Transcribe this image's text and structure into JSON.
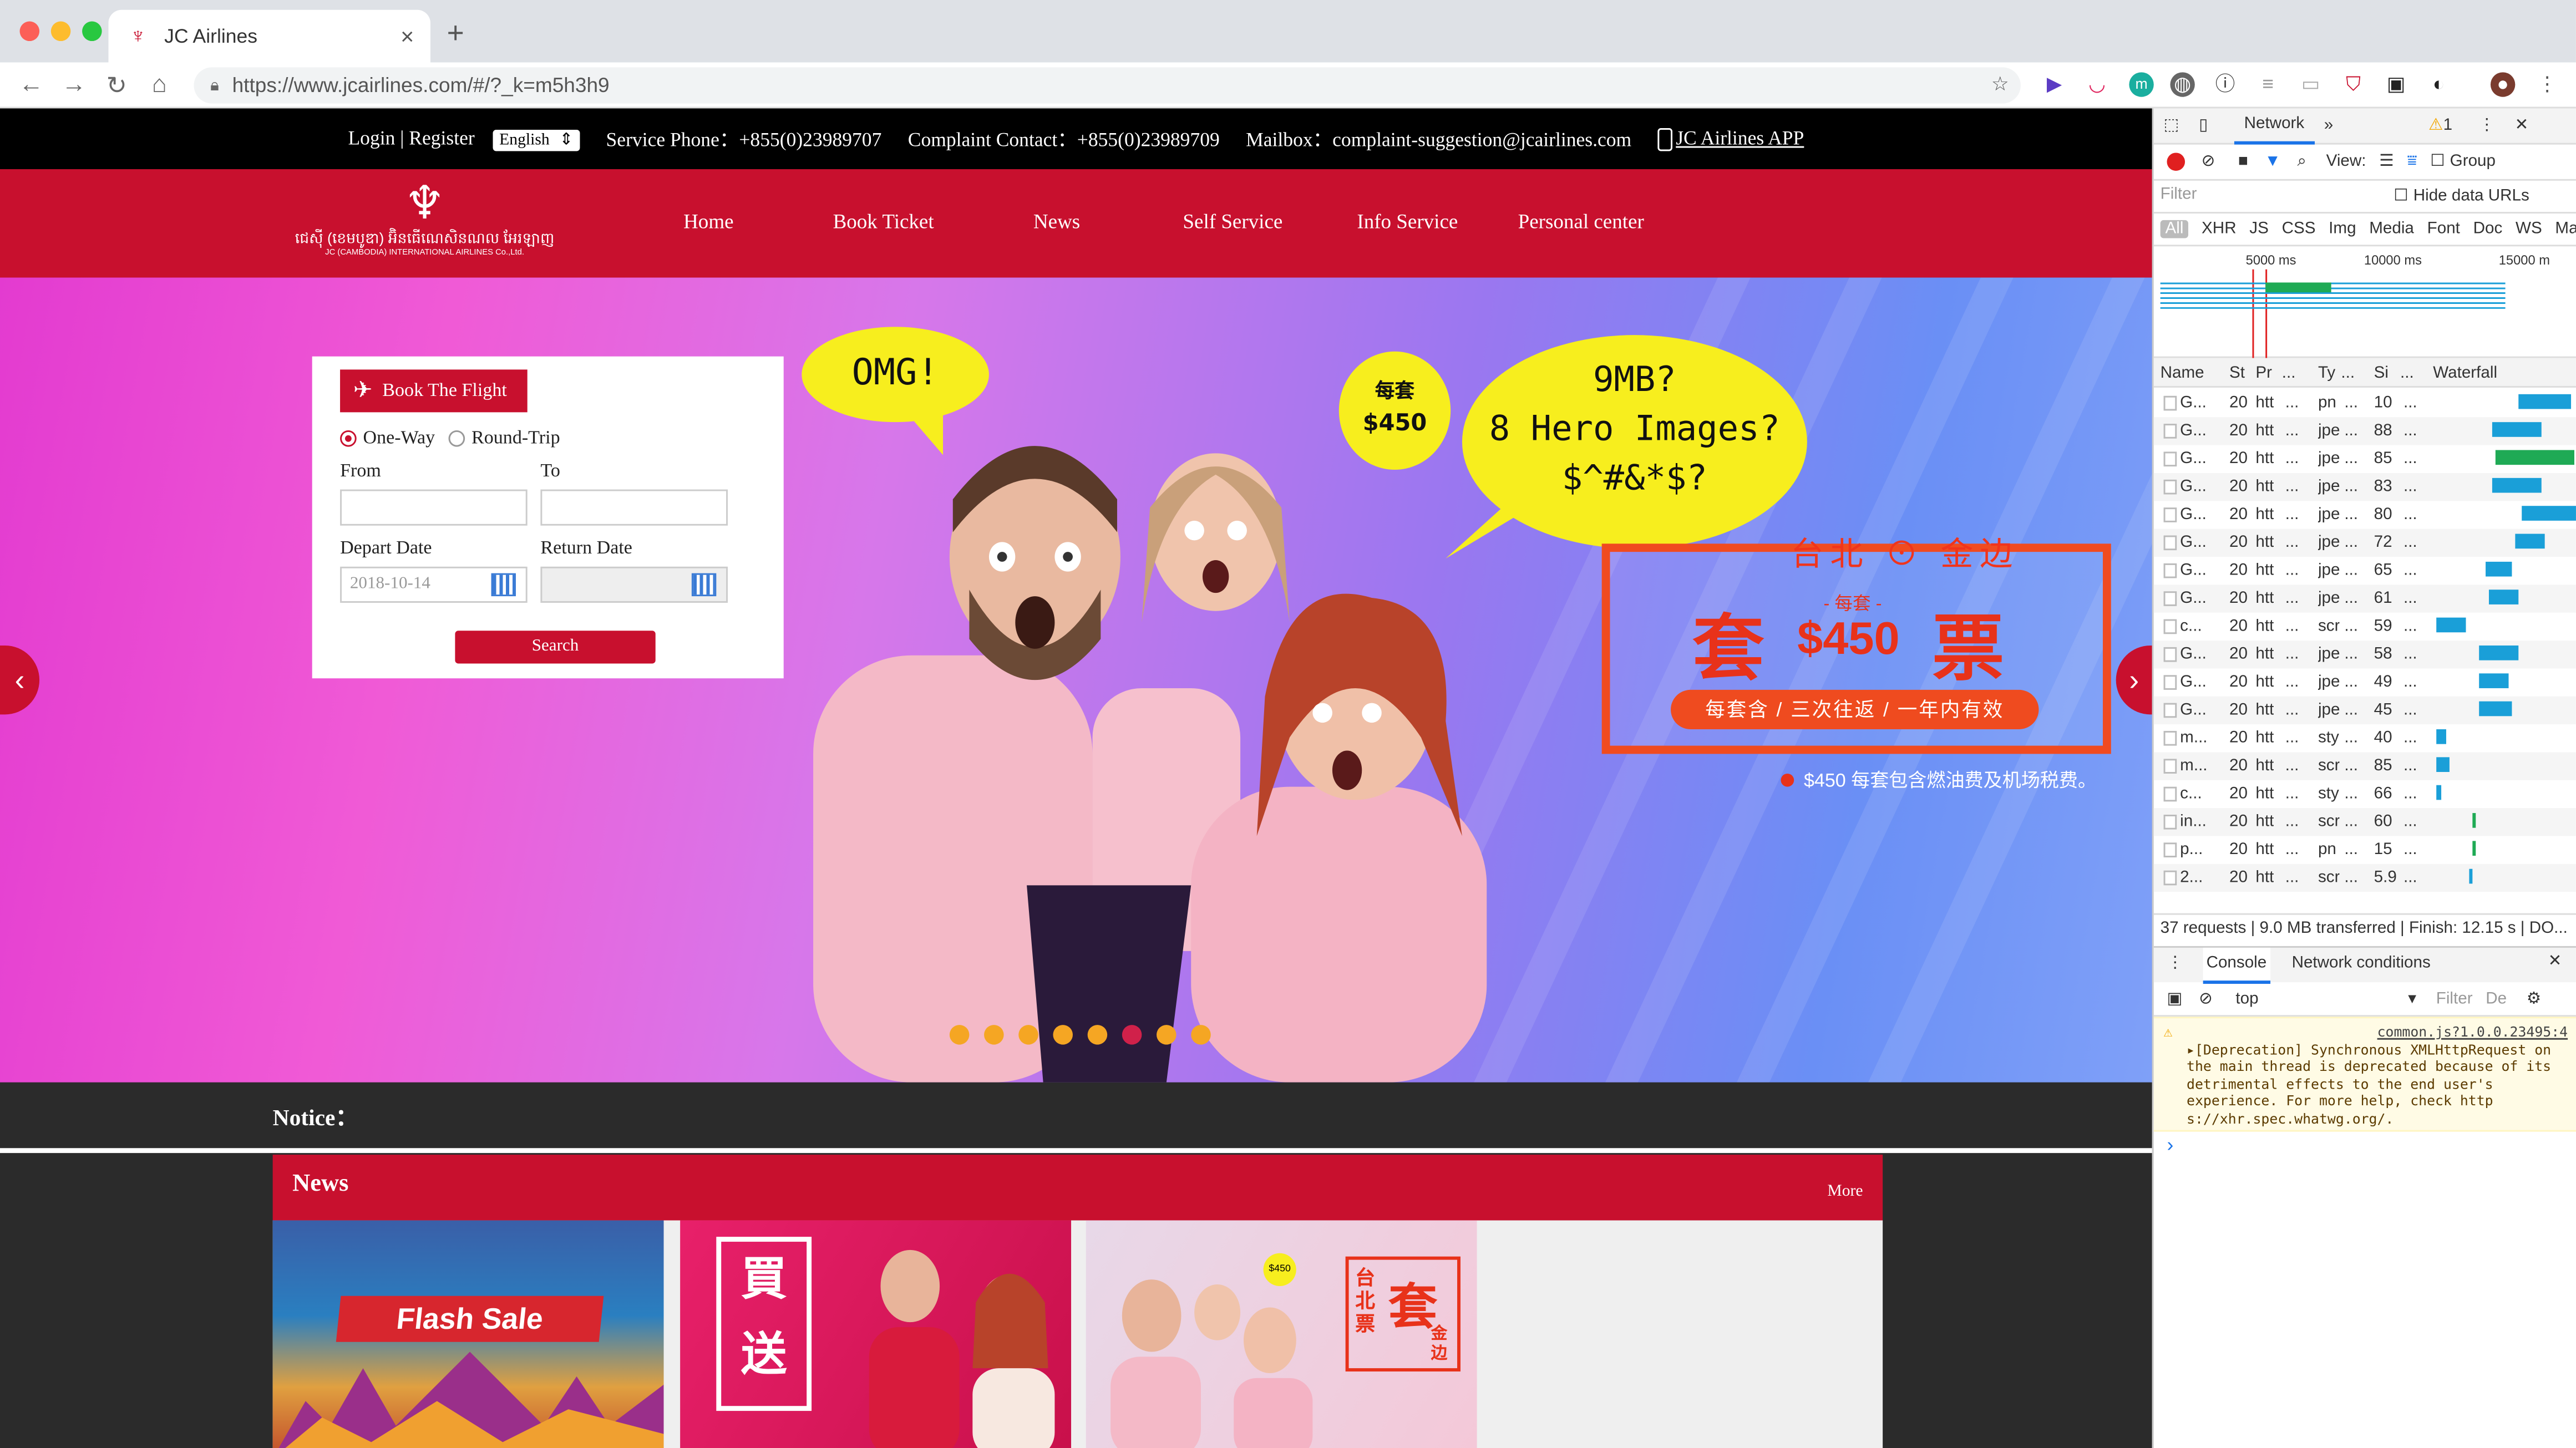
{
  "browser": {
    "tab_title": "JC Airlines",
    "url": "https://www.jcairlines.com/#/?_k=m5h3h9",
    "new_tab": "+",
    "close_tab": "×"
  },
  "topbar": {
    "login": "Login",
    "sep": "|",
    "register": "Register",
    "language": "English",
    "service_phone": "Service Phone：+855(0)23989707",
    "complaint": "Complaint Contact：+855(0)23989709",
    "mailbox": "Mailbox：complaint-suggestion@jcairlines.com",
    "app": "JC Airlines APP"
  },
  "logo": {
    "khmer": "ជេស៊ី (ខេមបូឌា) អ៊ិនធើណេសិនណល អែរឡាញ",
    "english": "JC (CAMBODIA) INTERNATIONAL AIRLINES Co.,Ltd."
  },
  "nav": [
    "Home",
    "Book Ticket",
    "News",
    "Self Service",
    "Info Service",
    "Personal center"
  ],
  "booking": {
    "title": "Book The Flight",
    "one_way": "One-Way",
    "round_trip": "Round-Trip",
    "from_label": "From",
    "to_label": "To",
    "depart_label": "Depart Date",
    "return_label": "Return Date",
    "depart_value": "2018-10-14",
    "search": "Search"
  },
  "hero": {
    "bubble_omg": "OMG!",
    "bubble_price_top": "每套",
    "bubble_price": "$450",
    "bubble_line1": "9MB?",
    "bubble_line2": "8 Hero Images?",
    "bubble_line3": "$^#&*$?",
    "promo_city": "台北 ⊙ 金边",
    "promo_char1": "套",
    "promo_per": "- 每套 -",
    "promo_price": "$450",
    "promo_char2": "票",
    "promo_pill": "每套含 / 三次往返 / 一年内有效",
    "promo_note": "$450 每套包含燃油费及机场税费。",
    "slides": 8,
    "active_slide": 6
  },
  "notice_label": "Notice：",
  "news": {
    "title": "News",
    "more": "More",
    "card1": "Flash Sale",
    "card2_a": "買",
    "card2_b": "送",
    "card3_a": "台北票",
    "card3_b": "套",
    "card3_c": "金边"
  },
  "devtools": {
    "panel": "Network",
    "more": "»",
    "warn_count": "1",
    "view_label": "View:",
    "group_label": "Group",
    "filter_placeholder": "Filter",
    "hide_data_urls": "Hide data URLs",
    "types": [
      "All",
      "XHR",
      "JS",
      "CSS",
      "Img",
      "Media",
      "Font",
      "Doc",
      "WS",
      "Mar"
    ],
    "timeline_ticks": [
      "5000 ms",
      "10000 ms",
      "15000 m"
    ],
    "columns": [
      "Name",
      "St",
      "Pr",
      "...",
      "Ty",
      "...",
      "Si",
      "...",
      "Waterfall"
    ],
    "requests": [
      {
        "name": "G...",
        "st": "20",
        "pr": "htt",
        "ty": "pn",
        "si": "10"
      },
      {
        "name": "G...",
        "st": "20",
        "pr": "htt",
        "ty": "jpe",
        "si": "88"
      },
      {
        "name": "G...",
        "st": "20",
        "pr": "htt",
        "ty": "jpe",
        "si": "85"
      },
      {
        "name": "G...",
        "st": "20",
        "pr": "htt",
        "ty": "jpe",
        "si": "83"
      },
      {
        "name": "G...",
        "st": "20",
        "pr": "htt",
        "ty": "jpe",
        "si": "80"
      },
      {
        "name": "G...",
        "st": "20",
        "pr": "htt",
        "ty": "jpe",
        "si": "72"
      },
      {
        "name": "G...",
        "st": "20",
        "pr": "htt",
        "ty": "jpe",
        "si": "65"
      },
      {
        "name": "G...",
        "st": "20",
        "pr": "htt",
        "ty": "jpe",
        "si": "61"
      },
      {
        "name": "c...",
        "st": "20",
        "pr": "htt",
        "ty": "scr",
        "si": "59"
      },
      {
        "name": "G...",
        "st": "20",
        "pr": "htt",
        "ty": "jpe",
        "si": "58"
      },
      {
        "name": "G...",
        "st": "20",
        "pr": "htt",
        "ty": "jpe",
        "si": "49"
      },
      {
        "name": "G...",
        "st": "20",
        "pr": "htt",
        "ty": "jpe",
        "si": "45"
      },
      {
        "name": "m...",
        "st": "20",
        "pr": "htt",
        "ty": "sty",
        "si": "40"
      },
      {
        "name": "m...",
        "st": "20",
        "pr": "htt",
        "ty": "scr",
        "si": "85"
      },
      {
        "name": "c...",
        "st": "20",
        "pr": "htt",
        "ty": "sty",
        "si": "66"
      },
      {
        "name": "in...",
        "st": "20",
        "pr": "htt",
        "ty": "scr",
        "si": "60"
      },
      {
        "name": "p...",
        "st": "20",
        "pr": "htt",
        "ty": "pn",
        "si": "15"
      },
      {
        "name": "2...",
        "st": "20",
        "pr": "htt",
        "ty": "scr",
        "si": "5.9"
      }
    ],
    "summary": "37 requests | 9.0 MB transferred | Finish: 12.15 s | DO...",
    "console_tab": "Console",
    "netcond_tab": "Network conditions",
    "context": "top",
    "console_filter": "Filter",
    "console_levels": "De",
    "warning_source": "common.js?1.0.0.23495:4",
    "warning_text": "▸[Deprecation] Synchronous XMLHttpRequest on the main thread is deprecated because of its detrimental effects to the end user's experience. For more help, check http s://xhr.spec.whatwg.org/.",
    "prompt": "›"
  },
  "colors": {
    "brand_red": "#c8102e",
    "bubble_yellow": "#f7ee1e",
    "promo_orange": "#ef4b1f"
  }
}
